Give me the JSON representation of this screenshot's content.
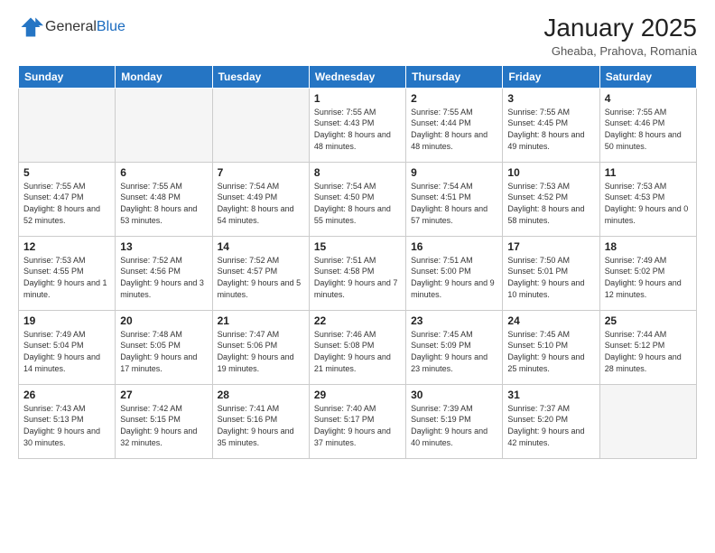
{
  "header": {
    "logo_general": "General",
    "logo_blue": "Blue",
    "month_title": "January 2025",
    "location": "Gheaba, Prahova, Romania"
  },
  "weekdays": [
    "Sunday",
    "Monday",
    "Tuesday",
    "Wednesday",
    "Thursday",
    "Friday",
    "Saturday"
  ],
  "weeks": [
    [
      {
        "day": "",
        "empty": true
      },
      {
        "day": "",
        "empty": true
      },
      {
        "day": "",
        "empty": true
      },
      {
        "day": "1",
        "sunrise": "7:55 AM",
        "sunset": "4:43 PM",
        "daylight": "8 hours and 48 minutes."
      },
      {
        "day": "2",
        "sunrise": "7:55 AM",
        "sunset": "4:44 PM",
        "daylight": "8 hours and 48 minutes."
      },
      {
        "day": "3",
        "sunrise": "7:55 AM",
        "sunset": "4:45 PM",
        "daylight": "8 hours and 49 minutes."
      },
      {
        "day": "4",
        "sunrise": "7:55 AM",
        "sunset": "4:46 PM",
        "daylight": "8 hours and 50 minutes."
      }
    ],
    [
      {
        "day": "5",
        "sunrise": "7:55 AM",
        "sunset": "4:47 PM",
        "daylight": "8 hours and 52 minutes."
      },
      {
        "day": "6",
        "sunrise": "7:55 AM",
        "sunset": "4:48 PM",
        "daylight": "8 hours and 53 minutes."
      },
      {
        "day": "7",
        "sunrise": "7:54 AM",
        "sunset": "4:49 PM",
        "daylight": "8 hours and 54 minutes."
      },
      {
        "day": "8",
        "sunrise": "7:54 AM",
        "sunset": "4:50 PM",
        "daylight": "8 hours and 55 minutes."
      },
      {
        "day": "9",
        "sunrise": "7:54 AM",
        "sunset": "4:51 PM",
        "daylight": "8 hours and 57 minutes."
      },
      {
        "day": "10",
        "sunrise": "7:53 AM",
        "sunset": "4:52 PM",
        "daylight": "8 hours and 58 minutes."
      },
      {
        "day": "11",
        "sunrise": "7:53 AM",
        "sunset": "4:53 PM",
        "daylight": "9 hours and 0 minutes."
      }
    ],
    [
      {
        "day": "12",
        "sunrise": "7:53 AM",
        "sunset": "4:55 PM",
        "daylight": "9 hours and 1 minute."
      },
      {
        "day": "13",
        "sunrise": "7:52 AM",
        "sunset": "4:56 PM",
        "daylight": "9 hours and 3 minutes."
      },
      {
        "day": "14",
        "sunrise": "7:52 AM",
        "sunset": "4:57 PM",
        "daylight": "9 hours and 5 minutes."
      },
      {
        "day": "15",
        "sunrise": "7:51 AM",
        "sunset": "4:58 PM",
        "daylight": "9 hours and 7 minutes."
      },
      {
        "day": "16",
        "sunrise": "7:51 AM",
        "sunset": "5:00 PM",
        "daylight": "9 hours and 9 minutes."
      },
      {
        "day": "17",
        "sunrise": "7:50 AM",
        "sunset": "5:01 PM",
        "daylight": "9 hours and 10 minutes."
      },
      {
        "day": "18",
        "sunrise": "7:49 AM",
        "sunset": "5:02 PM",
        "daylight": "9 hours and 12 minutes."
      }
    ],
    [
      {
        "day": "19",
        "sunrise": "7:49 AM",
        "sunset": "5:04 PM",
        "daylight": "9 hours and 14 minutes."
      },
      {
        "day": "20",
        "sunrise": "7:48 AM",
        "sunset": "5:05 PM",
        "daylight": "9 hours and 17 minutes."
      },
      {
        "day": "21",
        "sunrise": "7:47 AM",
        "sunset": "5:06 PM",
        "daylight": "9 hours and 19 minutes."
      },
      {
        "day": "22",
        "sunrise": "7:46 AM",
        "sunset": "5:08 PM",
        "daylight": "9 hours and 21 minutes."
      },
      {
        "day": "23",
        "sunrise": "7:45 AM",
        "sunset": "5:09 PM",
        "daylight": "9 hours and 23 minutes."
      },
      {
        "day": "24",
        "sunrise": "7:45 AM",
        "sunset": "5:10 PM",
        "daylight": "9 hours and 25 minutes."
      },
      {
        "day": "25",
        "sunrise": "7:44 AM",
        "sunset": "5:12 PM",
        "daylight": "9 hours and 28 minutes."
      }
    ],
    [
      {
        "day": "26",
        "sunrise": "7:43 AM",
        "sunset": "5:13 PM",
        "daylight": "9 hours and 30 minutes."
      },
      {
        "day": "27",
        "sunrise": "7:42 AM",
        "sunset": "5:15 PM",
        "daylight": "9 hours and 32 minutes."
      },
      {
        "day": "28",
        "sunrise": "7:41 AM",
        "sunset": "5:16 PM",
        "daylight": "9 hours and 35 minutes."
      },
      {
        "day": "29",
        "sunrise": "7:40 AM",
        "sunset": "5:17 PM",
        "daylight": "9 hours and 37 minutes."
      },
      {
        "day": "30",
        "sunrise": "7:39 AM",
        "sunset": "5:19 PM",
        "daylight": "9 hours and 40 minutes."
      },
      {
        "day": "31",
        "sunrise": "7:37 AM",
        "sunset": "5:20 PM",
        "daylight": "9 hours and 42 minutes."
      },
      {
        "day": "",
        "empty": true
      }
    ]
  ]
}
